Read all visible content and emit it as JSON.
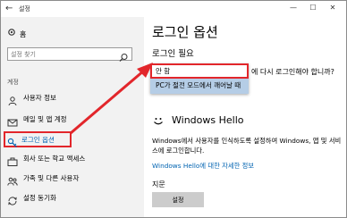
{
  "window": {
    "title": "설정",
    "back_glyph": "←",
    "controls": [
      "—",
      "☐",
      "✕"
    ]
  },
  "sidebar": {
    "home_label": "홈",
    "search_placeholder": "설정 찾기",
    "group_label": "계정",
    "items": [
      {
        "label": "사용자 정보",
        "icon": "person-card-icon"
      },
      {
        "label": "메일 및 앱 계정",
        "icon": "mail-icon"
      },
      {
        "label": "로그인 옵션",
        "icon": "key-icon",
        "active": true
      },
      {
        "label": "회사 또는 학교 액세스",
        "icon": "briefcase-icon"
      },
      {
        "label": "가족 및 다른 사용자",
        "icon": "people-icon"
      },
      {
        "label": "설정 동기화",
        "icon": "sync-icon"
      }
    ]
  },
  "content": {
    "page_title": "로그인 옵션",
    "section_title": "로그인 필요",
    "question": "에 다시 로그인해야 합니까?",
    "dropdown": {
      "options": [
        "안 함",
        "PC가 절전 모드에서 깨어날 때"
      ],
      "selected": "안 함"
    },
    "hello": {
      "title": "Windows Hello",
      "description": "Windows에서 사용자를 인식하도록 설정하여 Windows, 앱 및 서비스에 로그인합니다.",
      "link": "Windows Hello에 대한 자세한 정보"
    },
    "fingerprint_label": "지문",
    "setup_button": "설정"
  },
  "colors": {
    "accent": "#0063b1",
    "highlight": "#e2262b",
    "sidebar_bg": "#f2f2f2",
    "dropdown_hover": "#b5cde6"
  }
}
